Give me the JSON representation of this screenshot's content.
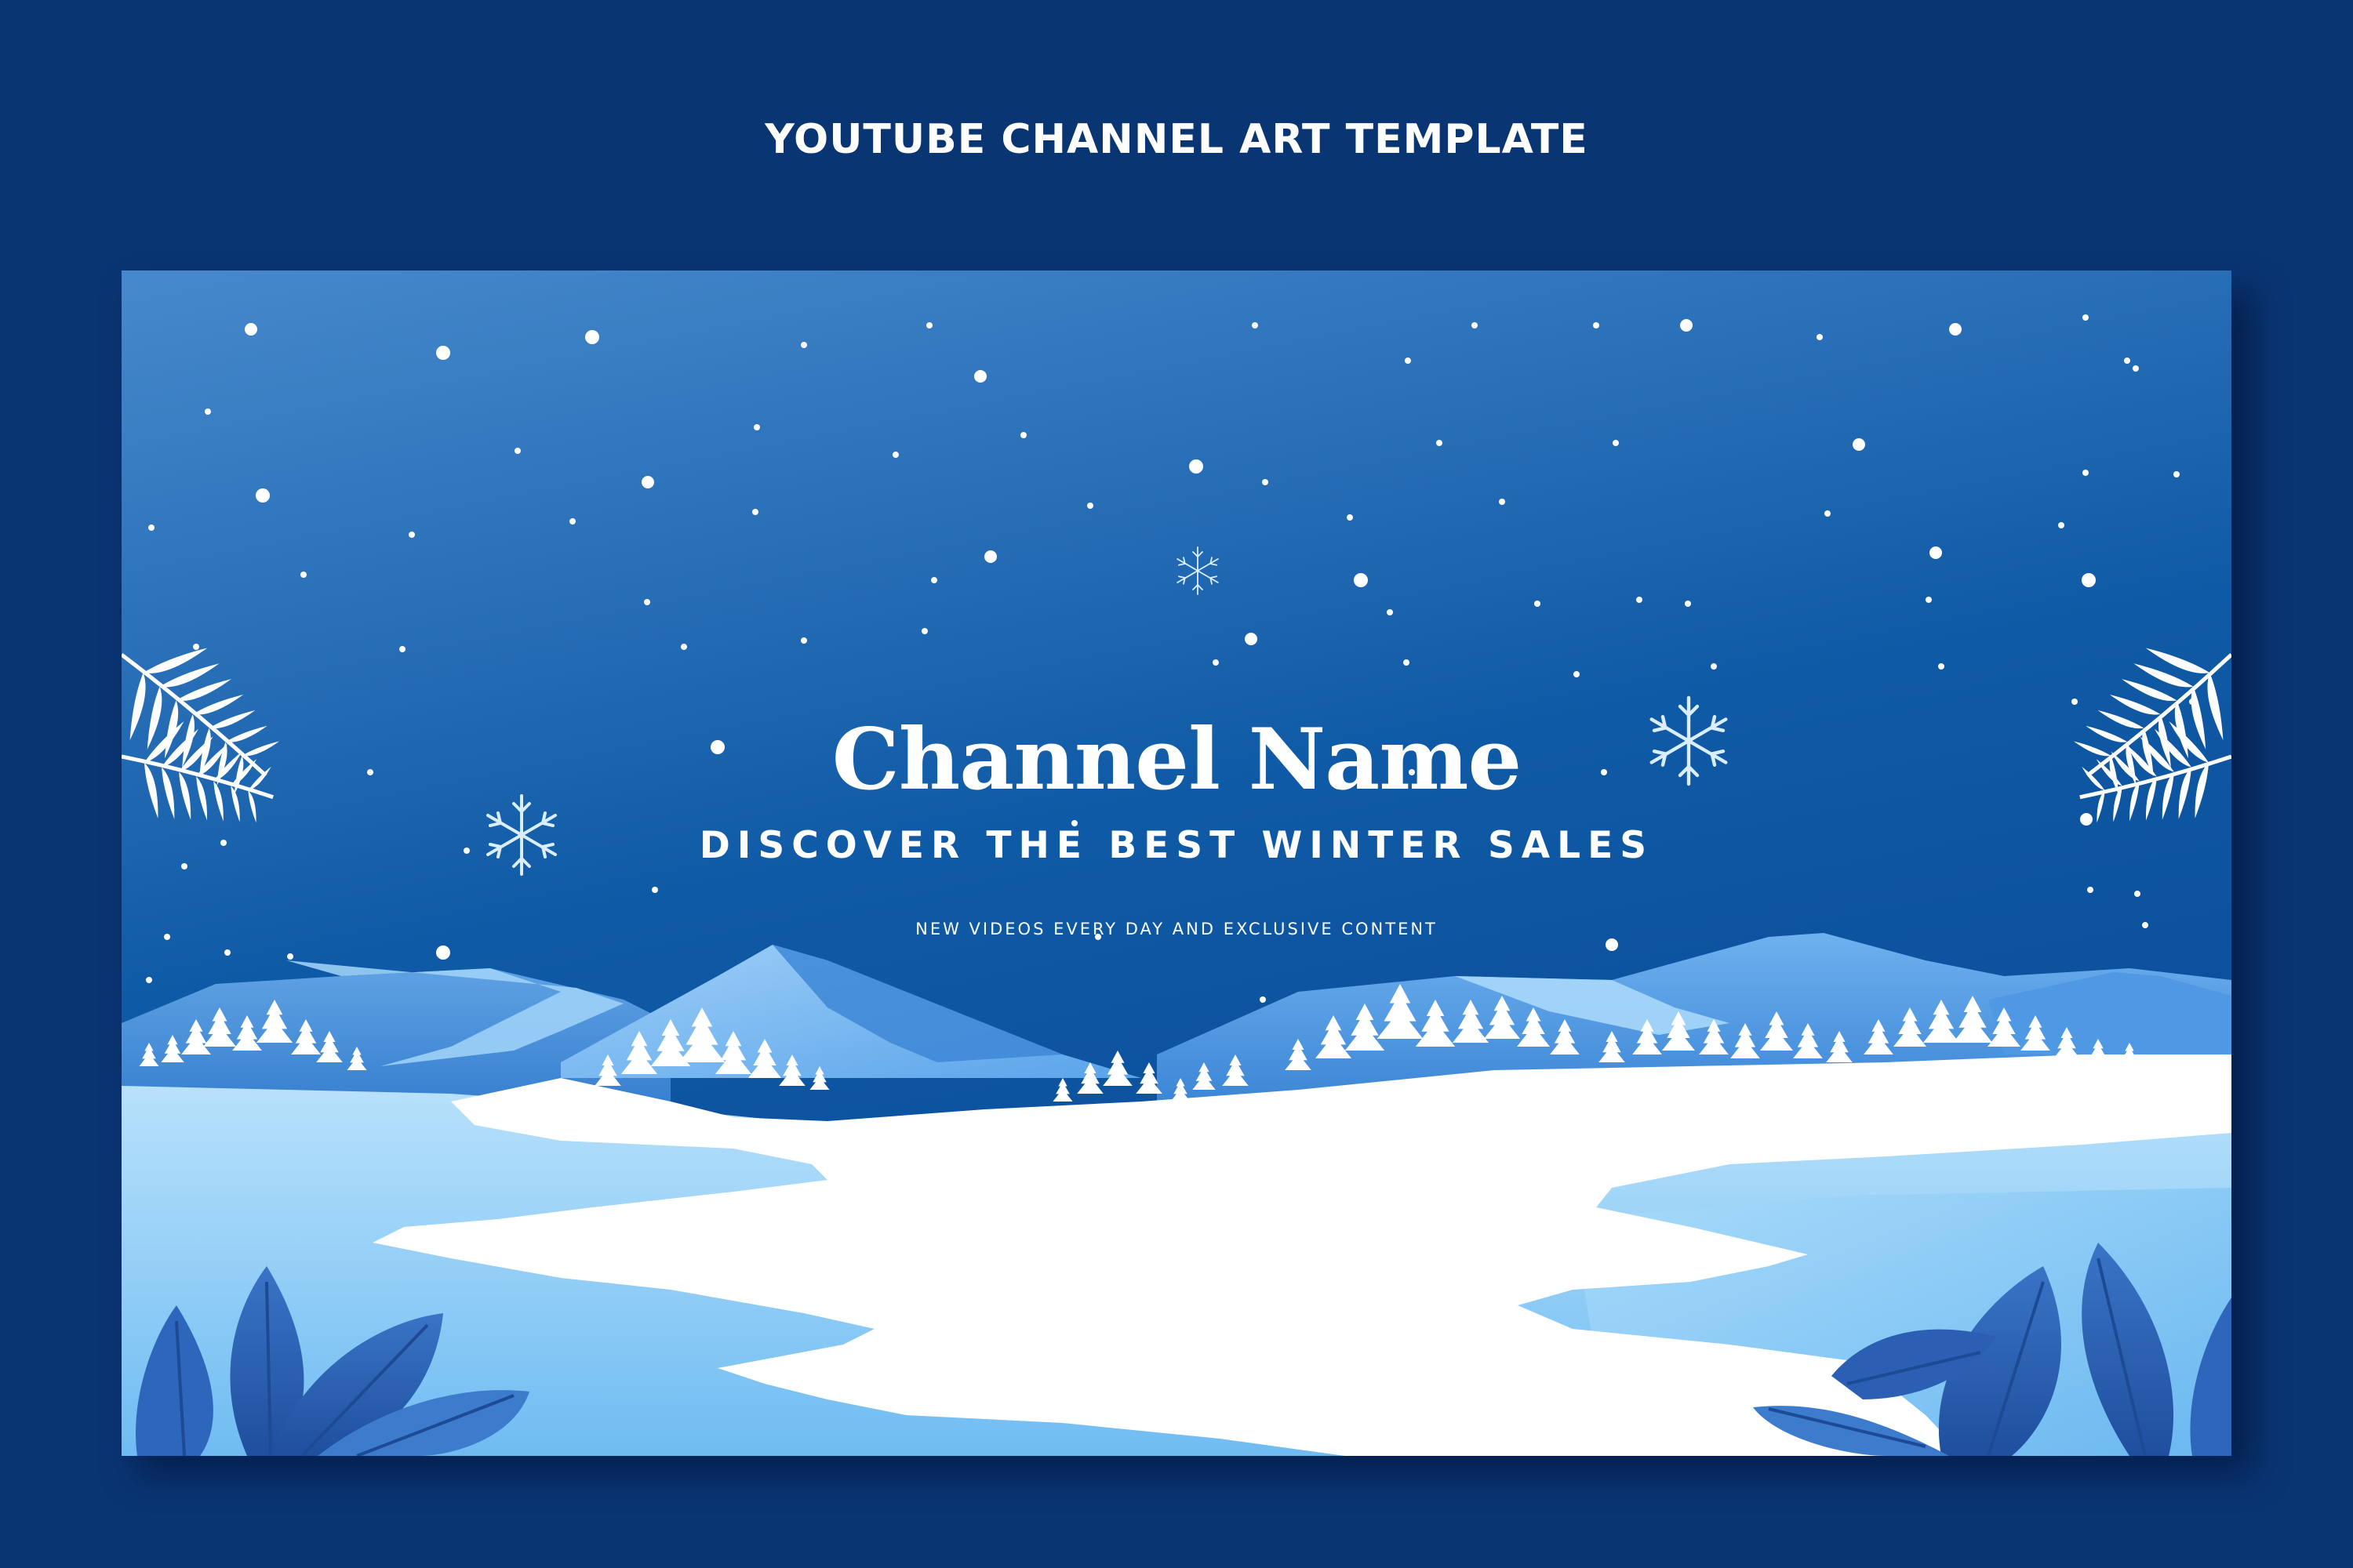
{
  "header": {
    "title": "YOUTUBE CHANNEL ART TEMPLATE"
  },
  "banner": {
    "channel_name": "Channel Name",
    "tagline": "DISCOVER THE BEST WINTER SALES",
    "subline": "NEW VIDEOS EVERY DAY AND EXCLUSIVE CONTENT"
  },
  "icons": [
    "moon-icon",
    "snowflake-icon",
    "leaf-icon",
    "tree-icon"
  ],
  "colors": {
    "page_background": "#0a3573",
    "sky_top": "#3e86c9",
    "sky_bottom": "#0a4f9c",
    "snow": "#ffffff",
    "ice": "#7fc4f5",
    "mountain": "#7db8ec",
    "foliage": "#2c62b8"
  }
}
